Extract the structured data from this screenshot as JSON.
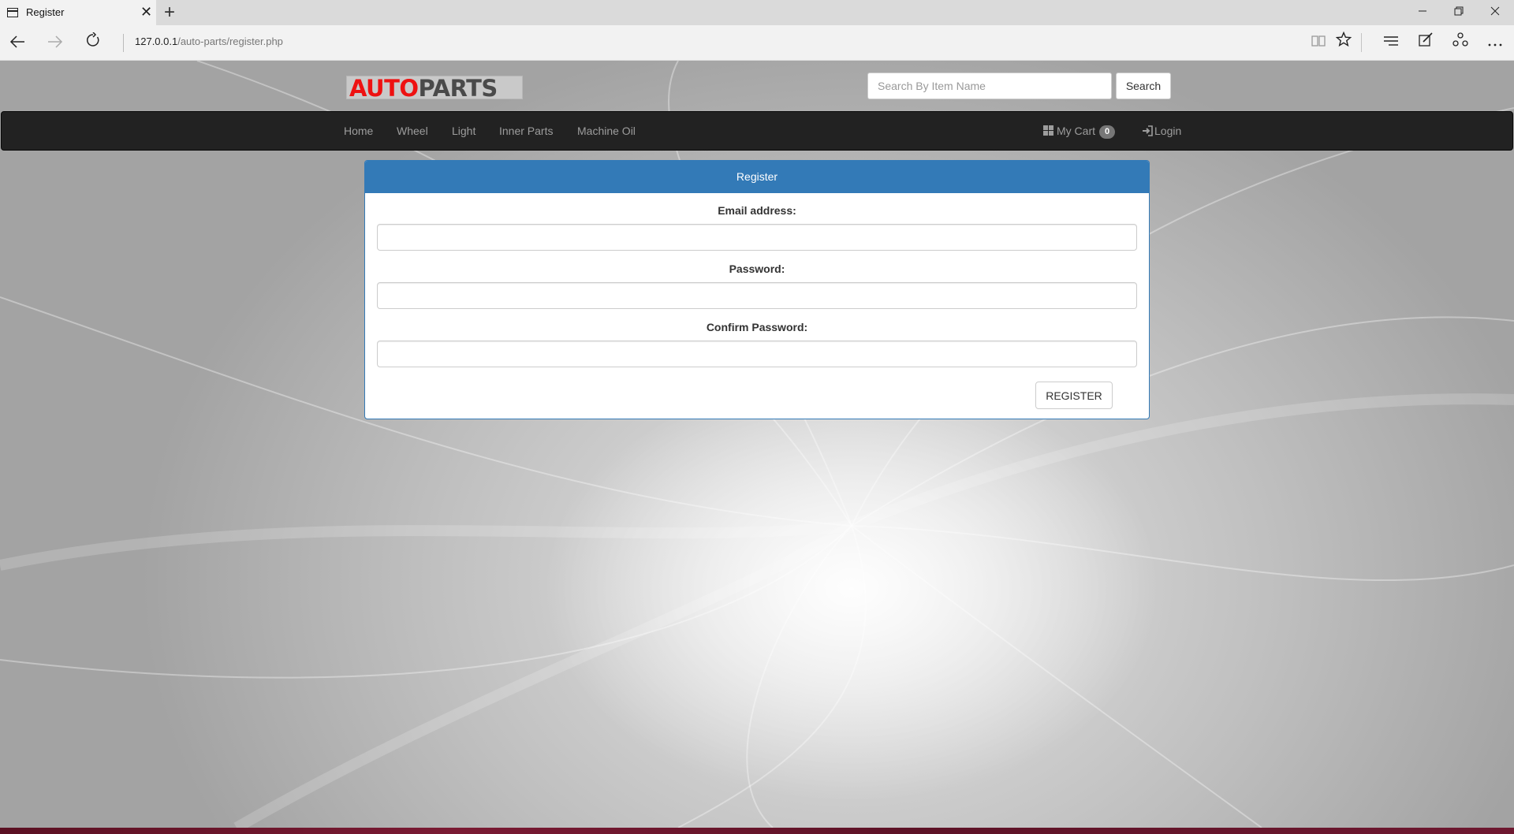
{
  "browser": {
    "tab_title": "Register",
    "new_tab_glyph": "+",
    "close_tab_glyph": "✕",
    "url_host": "127.0.0.1",
    "url_path": "/auto-parts/register.php",
    "icons": [
      "page-icon",
      "back-icon",
      "forward-icon",
      "refresh-icon",
      "reading-view-icon",
      "favorite-star-icon",
      "hub-icon",
      "web-note-icon",
      "share-icon",
      "more-icon",
      "minimize-icon",
      "restore-icon",
      "close-window-icon"
    ]
  },
  "header": {
    "logo_part1": "AUTO",
    "logo_part2": "PARTS",
    "logo_colors": {
      "auto": "#ee1111",
      "parts": "#4a4a4a"
    },
    "search_placeholder": "Search By Item Name",
    "search_button": "Search"
  },
  "navbar": {
    "items": [
      {
        "label": "Home"
      },
      {
        "label": "Wheel"
      },
      {
        "label": "Light"
      },
      {
        "label": "Inner Parts"
      },
      {
        "label": "Machine Oil"
      }
    ],
    "cart_label": "My Cart",
    "cart_count": "0",
    "login_label": "Login",
    "background": "#222222",
    "link_color": "#9d9d9d"
  },
  "register_panel": {
    "title": "Register",
    "email_label": "Email address:",
    "email_value": "",
    "password_label": "Password:",
    "password_value": "",
    "confirm_label": "Confirm Password:",
    "confirm_value": "",
    "submit_label": "REGISTER",
    "accent": "#337ab7"
  }
}
